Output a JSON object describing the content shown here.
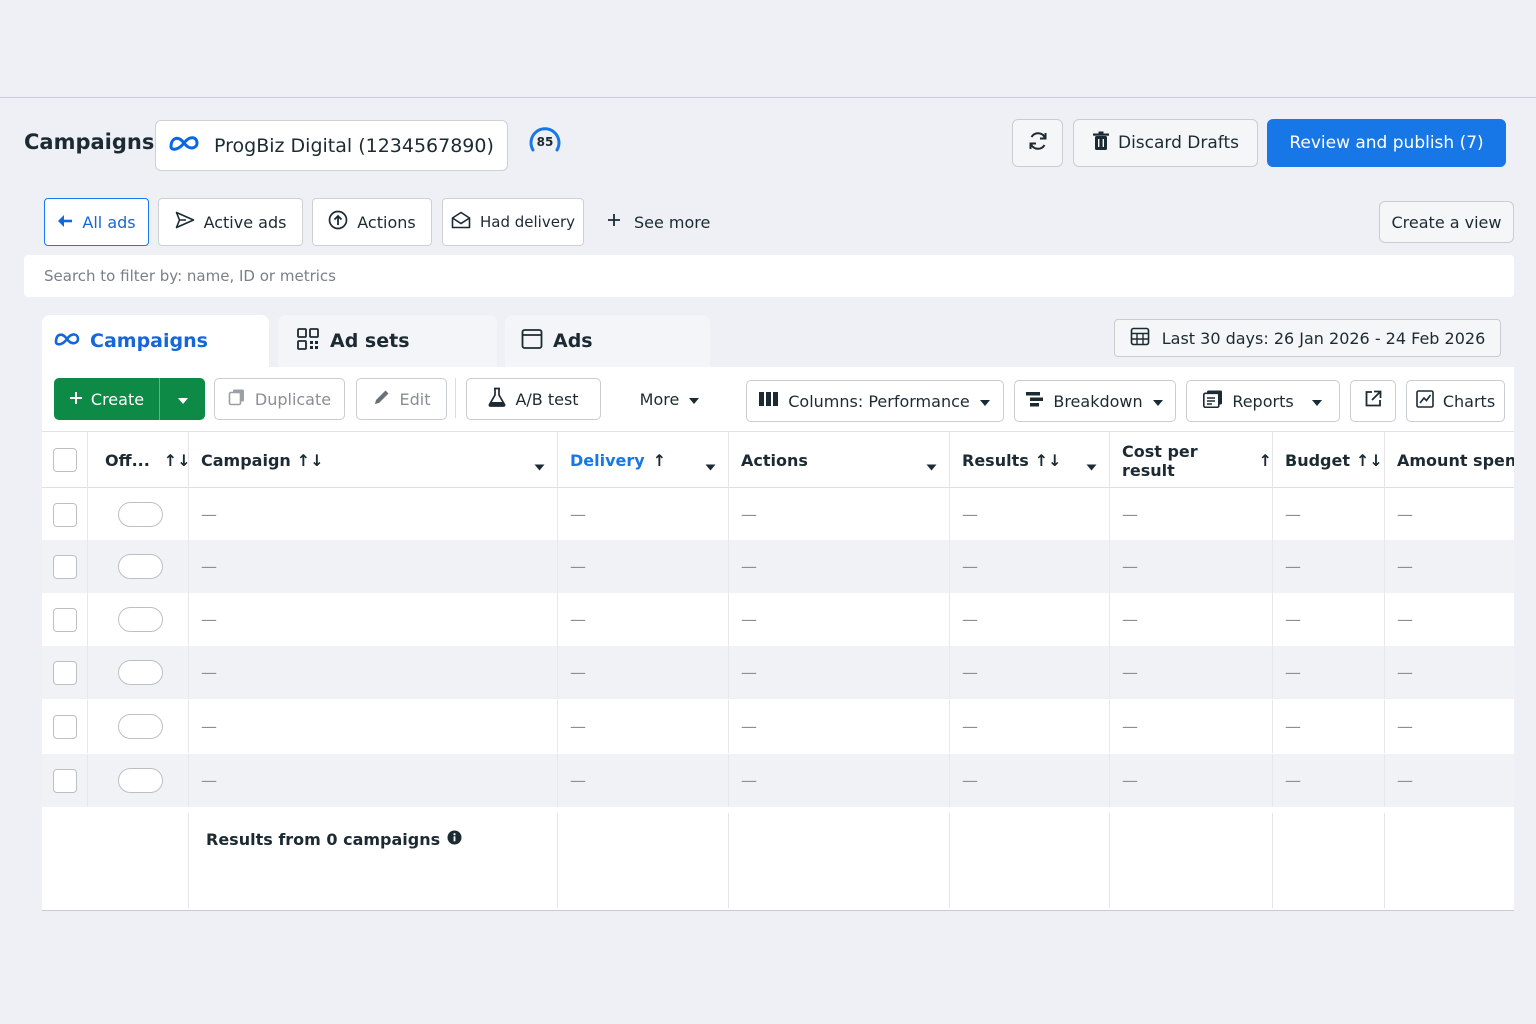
{
  "header": {
    "title": "Campaigns",
    "account_name": "ProgBiz Digital (1234567890)",
    "score": "85",
    "discard_label": "Discard Drafts",
    "publish_label": "Review and publish (7)"
  },
  "filters": {
    "chips": [
      {
        "label": "All ads",
        "icon": "back-arrow-icon"
      },
      {
        "label": "Active ads",
        "icon": "send-icon"
      },
      {
        "label": "Actions",
        "icon": "upload-circle-icon"
      },
      {
        "label": "Had delivery",
        "icon": "envelope-open-icon"
      }
    ],
    "see_more": "See more",
    "create_view": "Create a view"
  },
  "search": {
    "placeholder": "Search to filter by: name, ID or metrics"
  },
  "level_tabs": [
    {
      "label": "Campaigns",
      "icon": "meta-icon"
    },
    {
      "label": "Ad sets",
      "icon": "grid-icon"
    },
    {
      "label": "Ads",
      "icon": "window-icon"
    }
  ],
  "date_range": "Last 30 days: 26 Jan 2026 - 24 Feb 2026",
  "toolbar": {
    "create": "Create",
    "duplicate": "Duplicate",
    "edit": "Edit",
    "ab_test": "A/B test",
    "more": "More",
    "columns": "Columns: Performance",
    "breakdown": "Breakdown",
    "reports": "Reports",
    "charts": "Charts"
  },
  "table": {
    "columns": [
      {
        "label": "Off...",
        "sort": "↑↓"
      },
      {
        "label": "Campaign",
        "sort": "↑↓"
      },
      {
        "label": "Delivery",
        "sort": "↑"
      },
      {
        "label": "Actions",
        "sort": ""
      },
      {
        "label": "Results",
        "sort": "↑↓"
      },
      {
        "label": "Cost per result",
        "sort": "↑"
      },
      {
        "label": "Budget",
        "sort": "↑↓"
      },
      {
        "label": "Amount spent",
        "sort": ""
      }
    ],
    "empty_cell": "—",
    "footer": "Results from 0 campaigns"
  },
  "colors": {
    "primary": "#1877e6",
    "create_green": "#0d8a45",
    "text": "#1c2b33",
    "muted": "#8a8f95"
  }
}
